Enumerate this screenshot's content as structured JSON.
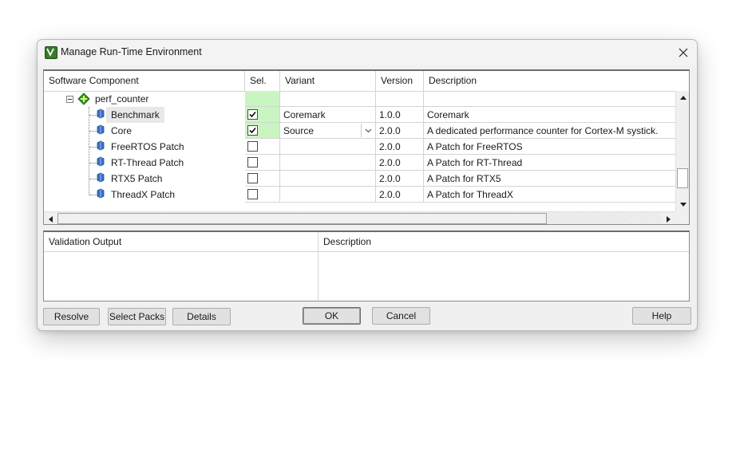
{
  "window": {
    "title": "Manage Run-Time Environment"
  },
  "grid": {
    "headers": {
      "component": "Software Component",
      "sel": "Sel.",
      "variant": "Variant",
      "version": "Version",
      "description": "Description"
    },
    "parent": {
      "label": "perf_counter"
    },
    "rows": [
      {
        "label": "Benchmark",
        "checked": true,
        "variant": "Coremark",
        "version": "1.0.0",
        "description": "Coremark"
      },
      {
        "label": "Core",
        "checked": true,
        "variant": "Source",
        "version": "2.0.0",
        "description": "A dedicated performance counter for Cortex-M systick."
      },
      {
        "label": "FreeRTOS Patch",
        "checked": false,
        "variant": "",
        "version": "2.0.0",
        "description": "A Patch for FreeRTOS"
      },
      {
        "label": "RT-Thread Patch",
        "checked": false,
        "variant": "",
        "version": "2.0.0",
        "description": "A Patch for RT-Thread"
      },
      {
        "label": "RTX5 Patch",
        "checked": false,
        "variant": "",
        "version": "2.0.0",
        "description": "A Patch for RTX5"
      },
      {
        "label": "ThreadX Patch",
        "checked": false,
        "variant": "",
        "version": "2.0.0",
        "description": "A Patch for ThreadX"
      }
    ]
  },
  "validation": {
    "headers": {
      "output": "Validation Output",
      "description": "Description"
    }
  },
  "buttons": {
    "resolve": "Resolve",
    "select_packs": "Select Packs",
    "details": "Details",
    "ok": "OK",
    "cancel": "Cancel",
    "help": "Help"
  },
  "colors": {
    "selection_ok": "#c9f5c0",
    "component_icon": "#3a72c9",
    "group_icon": "#2f9a2f"
  },
  "icons": {
    "app": "keil-app-icon",
    "close": "close-icon",
    "group": "component-group-icon",
    "component": "component-icon",
    "check": "checkmark-icon",
    "dropdown": "chevron-down-icon"
  }
}
